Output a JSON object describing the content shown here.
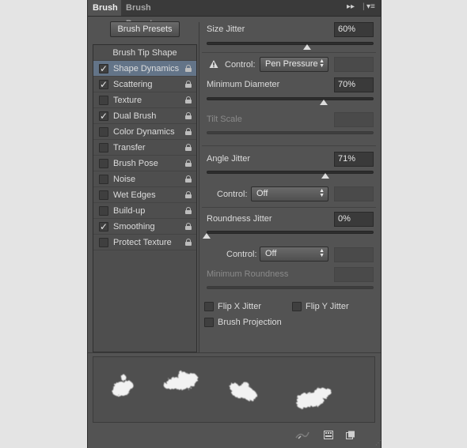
{
  "tabs": {
    "brush": "Brush",
    "brush_presets": "Brush Presets"
  },
  "icons": {
    "collapse": "double-chevron-right-icon",
    "menu": "panel-menu-icon",
    "warning": "warning-triangle-icon",
    "lock": "lock-icon",
    "brush_tool": "brush-stroke-icon",
    "grid": "grid-icon",
    "new": "new-brush-icon"
  },
  "left": {
    "presets_button": "Brush Presets",
    "tip_shape": "Brush Tip Shape",
    "items": [
      {
        "label": "Shape Dynamics",
        "checked": true,
        "selected": true
      },
      {
        "label": "Scattering",
        "checked": true
      },
      {
        "label": "Texture",
        "checked": false
      },
      {
        "label": "Dual Brush",
        "checked": true
      },
      {
        "label": "Color Dynamics",
        "checked": false
      },
      {
        "label": "Transfer",
        "checked": false
      },
      {
        "label": "Brush Pose",
        "checked": false
      },
      {
        "label": "Noise",
        "checked": false
      },
      {
        "label": "Wet Edges",
        "checked": false
      },
      {
        "label": "Build-up",
        "checked": false
      },
      {
        "label": "Smoothing",
        "checked": true
      },
      {
        "label": "Protect Texture",
        "checked": false
      }
    ]
  },
  "right": {
    "size_jitter": {
      "label": "Size Jitter",
      "value": "60%",
      "level": 0.6
    },
    "control1": {
      "label": "Control:",
      "value": "Pen Pressure"
    },
    "min_diameter": {
      "label": "Minimum Diameter",
      "value": "70%",
      "level": 0.7
    },
    "tilt_scale": {
      "label": "Tilt Scale"
    },
    "angle_jitter": {
      "label": "Angle Jitter",
      "value": "71%",
      "level": 0.71
    },
    "control2": {
      "label": "Control:",
      "value": "Off"
    },
    "roundness_jitter": {
      "label": "Roundness Jitter",
      "value": "0%",
      "level": 0
    },
    "control3": {
      "label": "Control:",
      "value": "Off"
    },
    "min_roundness": {
      "label": "Minimum Roundness"
    },
    "flip_x": {
      "label": "Flip X Jitter",
      "checked": false
    },
    "flip_y": {
      "label": "Flip Y Jitter",
      "checked": false
    },
    "projection": {
      "label": "Brush Projection",
      "checked": false
    }
  }
}
